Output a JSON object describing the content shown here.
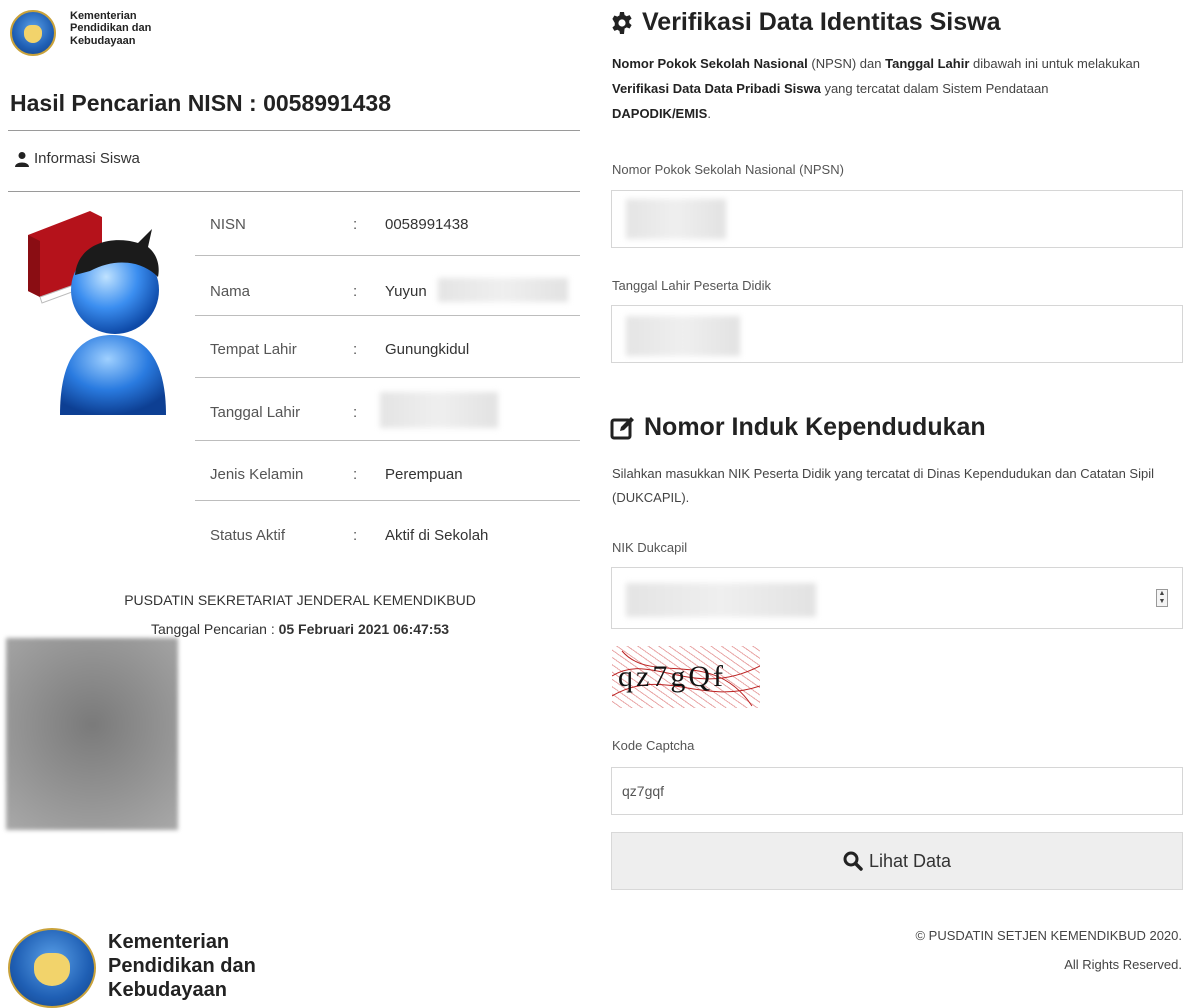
{
  "header": {
    "logo_lines": [
      "Kementerian",
      "Pendidikan dan",
      "Kebudayaan"
    ]
  },
  "result": {
    "title": "Hasil Pencarian NISN : 0058991438",
    "info_heading": "Informasi Siswa",
    "rows": [
      {
        "label": "NISN",
        "colon": ":",
        "value": "0058991438"
      },
      {
        "label": "Nama",
        "colon": ":",
        "value": "Yuyun"
      },
      {
        "label": "Tempat Lahir",
        "colon": ":",
        "value": "Gunungkidul"
      },
      {
        "label": "Tanggal Lahir",
        "colon": ":",
        "value": ""
      },
      {
        "label": "Jenis Kelamin",
        "colon": ":",
        "value": "Perempuan"
      },
      {
        "label": "Status Aktif",
        "colon": ":",
        "value": "Aktif di Sekolah"
      }
    ],
    "org": "PUSDATIN SEKRETARIAT JENDERAL KEMENDIKBUD",
    "search_date_label": "Tanggal Pencarian : ",
    "search_date_value": "05 Februari 2021 06:47:53"
  },
  "verify": {
    "title": "Verifikasi Data Identitas Siswa",
    "desc": {
      "p1b": "Nomor Pokok Sekolah Nasional",
      "p2": " (",
      "p3b": "NPSN",
      "p4": ") dan ",
      "p5b": "Tanggal Lahir",
      "p6": " dibawah ini untuk melakukan ",
      "p7b": "Verifikasi Data Data Pribadi Siswa",
      "p8": " yang tercatat dalam Sistem Pendataan ",
      "p9b": "DAPODIK/EMIS",
      "p10": "."
    },
    "npsn_label": "Nomor Pokok Sekolah Nasional (NPSN)",
    "npsn_value": "",
    "dob_label": "Tanggal Lahir Peserta Didik",
    "dob_value": ""
  },
  "nik": {
    "title": "Nomor Induk Kependudukan",
    "desc": "Silahkan masukkan NIK Peserta Didik yang tercatat di Dinas Kependudukan dan Catatan Sipil (DUKCAPIL).",
    "label": "NIK Dukcapil",
    "value": "",
    "captcha_image_text": "qz7gQf",
    "captcha_label": "Kode Captcha",
    "captcha_value": "qz7gqf",
    "button_label": "Lihat Data"
  },
  "footer": {
    "copyright": "© PUSDATIN SETJEN KEMENDIKBUD 2020.",
    "rights": "All Rights Reserved.",
    "logo_lines": [
      "Kementerian",
      "Pendidikan dan",
      "Kebudayaan"
    ]
  }
}
